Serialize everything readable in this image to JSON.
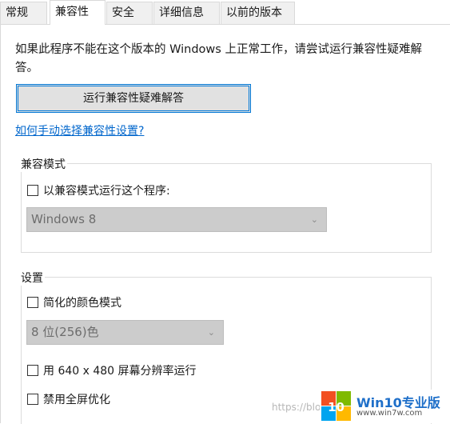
{
  "tabs": [
    {
      "label": "常规",
      "active": false
    },
    {
      "label": "兼容性",
      "active": true
    },
    {
      "label": "安全",
      "active": false
    },
    {
      "label": "详细信息",
      "active": false
    },
    {
      "label": "以前的版本",
      "active": false
    }
  ],
  "compat": {
    "description": "如果此程序不能在这个版本的 Windows 上正常工作，请尝试运行兼容性疑难解答。",
    "troubleshoot_button": "运行兼容性疑难解答",
    "help_link": "如何手动选择兼容性设置?"
  },
  "compat_mode": {
    "title": "兼容模式",
    "checkbox_label": "以兼容模式运行这个程序:",
    "checked": false,
    "os_select": "Windows 8"
  },
  "settings": {
    "title": "设置",
    "reduced_color_label": "简化的颜色模式",
    "color_select": "8 位(256)色",
    "resolution_label": "用 640 x 480 屏幕分辨率运行",
    "fullscreen_opt_label": "禁用全屏优化"
  },
  "watermark": {
    "url_text": "https://blog.csdn.net/...",
    "logo_number": "10",
    "brand_title": "Win10专业版",
    "site": "www.win7w.com"
  },
  "colors": {
    "accent": "#0078d7",
    "link": "#0066cc",
    "disabled_bg": "#cccccc"
  }
}
